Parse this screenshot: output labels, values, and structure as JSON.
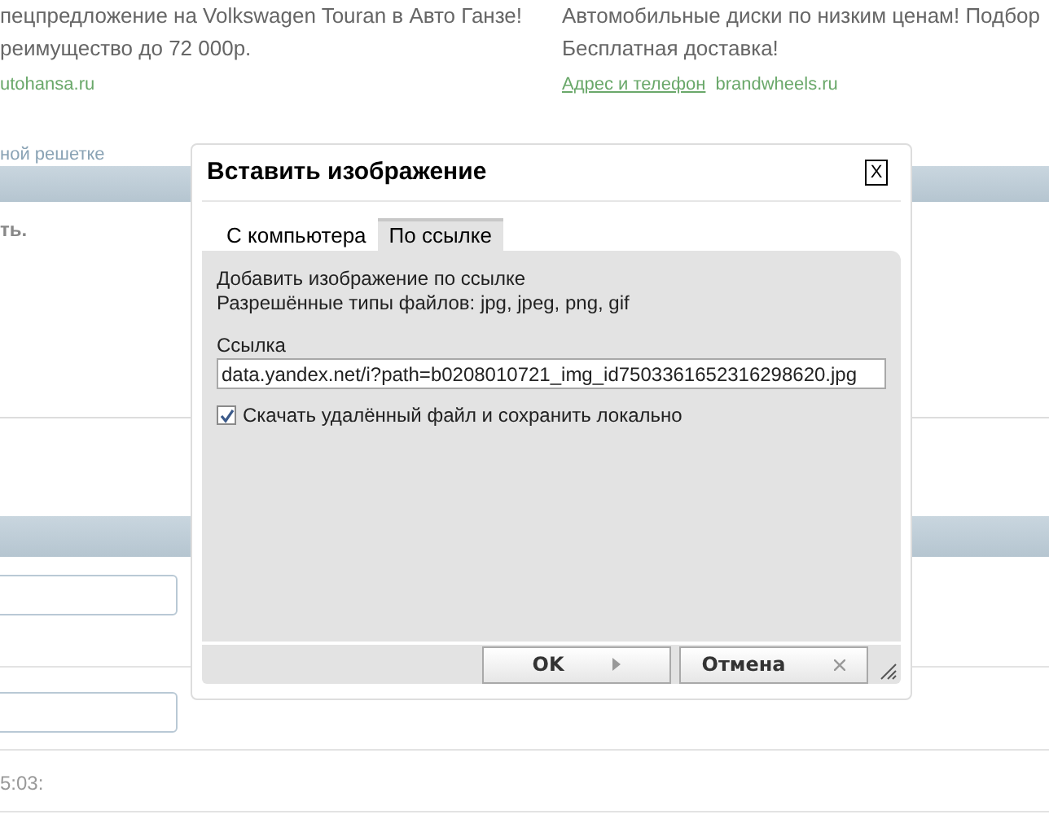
{
  "background": {
    "ads": [
      {
        "lines": [
          "пецпредложение на Volkswagen Touran в Авто Ганзе!",
          "реимущество до 72 000р."
        ],
        "links": [
          {
            "text": "utohansa.ru",
            "underlined": false
          }
        ]
      },
      {
        "lines": [
          "Автомобильные диски по низким ценам! Подбор",
          "Бесплатная доставка!"
        ],
        "links": [
          {
            "text": "Адрес и телефон",
            "underlined": true
          },
          {
            "text": "brandwheels.ru",
            "underlined": false
          }
        ]
      }
    ],
    "grid_link": "ной решетке",
    "section_heading": "ть.",
    "timestamp": "5:03:"
  },
  "dialog": {
    "title": "Вставить изображение",
    "close": "X",
    "tabs": [
      {
        "label": "С компьютера",
        "selected": false
      },
      {
        "label": "По ссылке",
        "selected": true
      }
    ],
    "description": [
      "Добавить изображение по ссылке",
      "Разрешённые типы файлов: jpg, jpeg, png, gif"
    ],
    "url_label": "Ссылка",
    "url_value": "data.yandex.net/i?path=b0208010721_img_id7503361652316298620.jpg",
    "download_option": {
      "label": "Скачать удалённый файл и сохранить локально",
      "checked": true
    },
    "buttons": [
      {
        "label": "OK",
        "kind": "ok"
      },
      {
        "label": "Отмена",
        "kind": "cancel"
      }
    ]
  }
}
